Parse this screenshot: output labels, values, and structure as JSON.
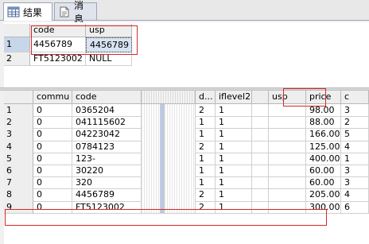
{
  "tabs": [
    {
      "label": "结果",
      "icon": "grid-icon",
      "active": true
    },
    {
      "label": "消息",
      "icon": "message-icon",
      "active": false
    }
  ],
  "result1": {
    "columns": [
      "code",
      "usp"
    ],
    "rows": [
      {
        "num": "1",
        "code": "4456789",
        "usp": "4456789"
      },
      {
        "num": "2",
        "code": "FT5123002",
        "usp": "NULL"
      }
    ]
  },
  "result2": {
    "columns": [
      "commu",
      "code",
      "",
      "d...",
      "iflevel2",
      "usp",
      "price",
      "c"
    ],
    "rows": [
      {
        "num": "1",
        "commu": "0",
        "code": "0365204",
        "d": "2",
        "iflevel2": "1",
        "usp": "",
        "price": "98.00",
        "c": "3"
      },
      {
        "num": "2",
        "commu": "0",
        "code": "041115602",
        "d": "1",
        "iflevel2": "1",
        "usp": "",
        "price": "88.00",
        "c": "2"
      },
      {
        "num": "3",
        "commu": "0",
        "code": "04223042",
        "d": "1",
        "iflevel2": "1",
        "usp": "",
        "price": "166.00",
        "c": "5"
      },
      {
        "num": "4",
        "commu": "0",
        "code": "0784123",
        "d": "2",
        "iflevel2": "1",
        "usp": "",
        "price": "125.00",
        "c": "4"
      },
      {
        "num": "5",
        "commu": "0",
        "code": "123-",
        "d": "1",
        "iflevel2": "1",
        "usp": "",
        "price": "400.00",
        "c": "1"
      },
      {
        "num": "6",
        "commu": "0",
        "code": "30220",
        "d": "1",
        "iflevel2": "1",
        "usp": "",
        "price": "60.00",
        "c": "3"
      },
      {
        "num": "7",
        "commu": "0",
        "code": "320",
        "d": "1",
        "iflevel2": "1",
        "usp": "",
        "price": "60.00",
        "c": "3"
      },
      {
        "num": "8",
        "commu": "0",
        "code": "4456789",
        "d": "2",
        "iflevel2": "1",
        "usp": "",
        "price": "205.00",
        "c": "4"
      },
      {
        "num": "9",
        "commu": "0",
        "code": "FT5123002",
        "d": "2",
        "iflevel2": "1",
        "usp": "",
        "price": "300.00",
        "c": "6"
      }
    ]
  },
  "colors": {
    "highlight": "#d62728",
    "selection": "#c8d6ea",
    "header": "#eeeeee"
  }
}
